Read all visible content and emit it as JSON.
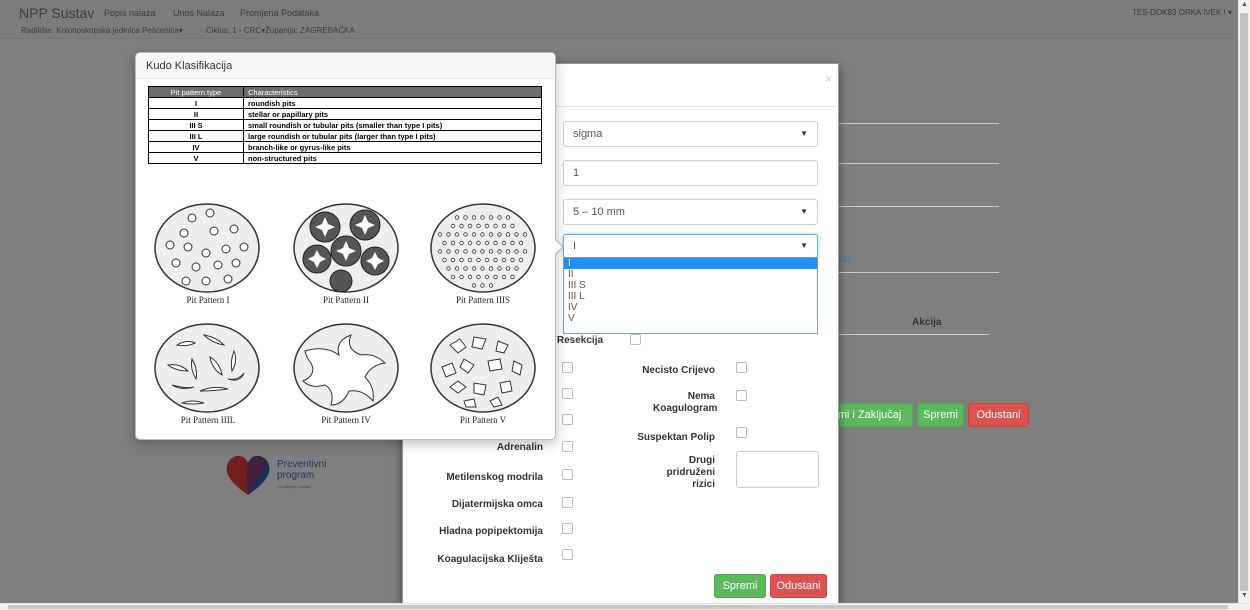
{
  "navbar": {
    "brand": "NPP Sustav",
    "links": [
      "Popis nalaza",
      "Unos Nalaza",
      "Promjena Podataka"
    ],
    "sub": {
      "radiliste": "Radilište: Kolonoskopska jedinica Pešćenica",
      "ciklus": "Ciklus: 1 - CRC",
      "zupanija": "Županija: ZAGREBAČKA"
    },
    "user": "TES-DOK83 ORKA IVEK !"
  },
  "page": {
    "link_fragment": "laz",
    "akcija_header": "Akcija",
    "btn_spremi_zakljucaj": "emi i Zaključaj",
    "btn_spremi": "Spremi",
    "btn_odustani": "Odustani"
  },
  "logo": {
    "line1": "Preventivni",
    "line2": "program",
    "tagline": "Za zdravlje. Danas."
  },
  "modal": {
    "close": "×",
    "select_lokacija": "sigma",
    "input_broj": "1",
    "select_velicina": "5 – 10 mm",
    "select_pit": "I",
    "pit_options": [
      "I",
      "II",
      "III S",
      "III L",
      "IV",
      "V"
    ],
    "selected_index": 0,
    "label_resekcija": "ka Resekcija",
    "left_labels": [
      "Adrenalin",
      "Metilenskog modrila",
      "Dijatermijska omca",
      "Hladna popipektomija",
      "Koagulacijska Kliješta"
    ],
    "right_labels": {
      "necisto": "Necisto Crijevo",
      "nema_koag": "Nema Koagulogram",
      "suspektan": "Suspektan Polip",
      "drugi": "Drugi pridruženi rizici"
    },
    "btn_save": "Spremi",
    "btn_cancel": "Odustani"
  },
  "kudo": {
    "title": "Kudo Klasifikacija",
    "table": {
      "headers": [
        "Pit pattern type",
        "Characteristics"
      ],
      "rows": [
        [
          "I",
          "roundish pits"
        ],
        [
          "II",
          "stellar or papillary pits"
        ],
        [
          "III S",
          "small roundish or tubular pits (smaller than type I pits)"
        ],
        [
          "III L",
          "large roundish or tubular pits (larger than type I pits)"
        ],
        [
          "IV",
          "branch-like or gyrus-like pits"
        ],
        [
          "V",
          "non-structured pits"
        ]
      ]
    },
    "captions": [
      "Pit Pattern I",
      "Pit Pattern II",
      "Pit Pattern IIIS",
      "Pit Pattern IIIL",
      "Pit Pattern IV",
      "Pit Pattern V"
    ]
  }
}
